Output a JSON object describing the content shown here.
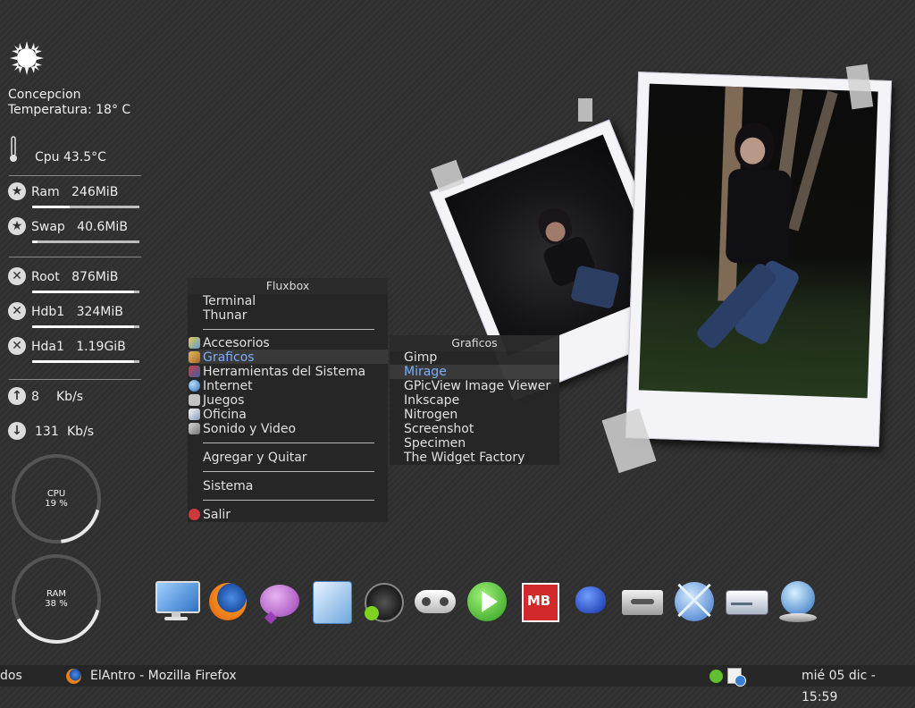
{
  "weather": {
    "city": "Concepcion",
    "temperature": "Temperatura: 18° C",
    "icon": "sun-icon"
  },
  "cpu_temp": "Cpu 43.5°C",
  "memory": [
    {
      "name": "Ram",
      "value": "246MiB",
      "level": 0.35
    },
    {
      "name": "Swap",
      "value": "40.6MiB",
      "level": 0.05
    }
  ],
  "disks": [
    {
      "name": "Root",
      "value": "876MiB",
      "level": 0.95
    },
    {
      "name": "Hdb1",
      "value": "324MiB",
      "level": 0.95
    },
    {
      "name": "Hda1",
      "value": "1.19GiB",
      "level": 0.95
    }
  ],
  "network": {
    "up_value": "8",
    "up_unit": "Kb/s",
    "down_value": "131",
    "down_unit": "Kb/s"
  },
  "gauges": {
    "cpu": {
      "label": "CPU",
      "percent_text": "19 %",
      "percent": 19
    },
    "ram": {
      "label": "RAM",
      "percent_text": "38 %",
      "percent": 38
    }
  },
  "menu": {
    "title": "Fluxbox",
    "items": {
      "terminal": "Terminal",
      "thunar": "Thunar",
      "accesorios": "Accesorios",
      "graficos": "Graficos",
      "herramientas": "Herramientas del Sistema",
      "internet": "Internet",
      "juegos": "Juegos",
      "oficina": "Oficina",
      "sonido": "Sonido y Video",
      "agregar": "Agregar y Quitar",
      "sistema": "Sistema",
      "salir": "Salir"
    }
  },
  "submenu": {
    "title": "Graficos",
    "items": [
      "Gimp",
      "Mirage",
      "GPicView Image Viewer",
      "Inkscape",
      "Nitrogen",
      "Screenshot",
      "Specimen",
      "The Widget Factory"
    ],
    "selected": "Mirage"
  },
  "dock": [
    "monitor-icon",
    "firefox-icon",
    "pidgin-icon",
    "office-writer-icon",
    "media-player-icon",
    "gamepad-icon",
    "play-icon",
    "mb-icon",
    "frog-icon",
    "cassette-icon",
    "atom-icon",
    "drive-icon",
    "network-globe-icon"
  ],
  "taskbar": {
    "workspace": "dos",
    "window_title": "ElAntro - Mozilla Firefox",
    "clock": "mié 05 dic - 15:59"
  },
  "colors": {
    "accent": "#7db3ff",
    "background": "#2f2f2f"
  }
}
